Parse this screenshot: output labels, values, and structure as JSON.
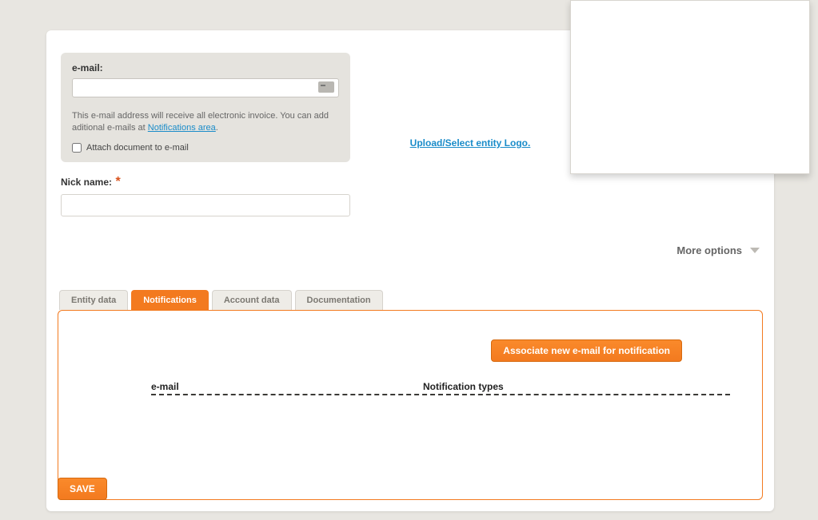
{
  "emailPanel": {
    "label": "e-mail:",
    "value": "",
    "helpPrefix": "This e-mail address will receive all electronic invoice. You can add aditional e-mails at ",
    "helpLink": "Notifications area",
    "helpSuffix": ".",
    "attachLabel": "Attach document to e-mail"
  },
  "nickname": {
    "label": "Nick name:",
    "requiredMark": "*",
    "value": ""
  },
  "logo": {
    "uploadLink": "Upload/Select entity Logo."
  },
  "moreOptions": {
    "label": "More options"
  },
  "tabs": {
    "entityData": "Entity data",
    "notifications": "Notifications",
    "accountData": "Account data",
    "documentation": "Documentation"
  },
  "notificationsPanel": {
    "assocButton": "Associate new e-mail for notification",
    "col1": "e-mail",
    "col2": "Notification types"
  },
  "saveButton": "SAVE"
}
